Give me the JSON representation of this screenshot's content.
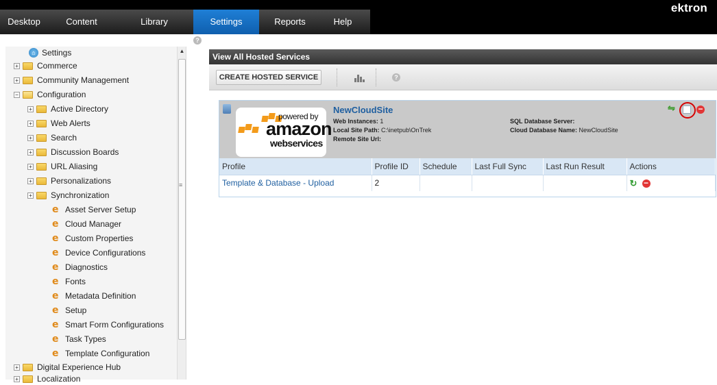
{
  "app": {
    "logo": "ektron"
  },
  "nav": {
    "tabs": [
      {
        "label": "Desktop"
      },
      {
        "label": "Content"
      },
      {
        "label": "Library"
      },
      {
        "label": "Settings",
        "active": true
      },
      {
        "label": "Reports"
      },
      {
        "label": "Help"
      }
    ]
  },
  "sidebar": {
    "root": "Settings",
    "items": [
      {
        "label": "Commerce",
        "type": "folder",
        "expander": "+"
      },
      {
        "label": "Community Management",
        "type": "folder",
        "expander": "+"
      },
      {
        "label": "Configuration",
        "type": "folder-open",
        "expander": "−"
      },
      {
        "label": "Active Directory",
        "type": "folder",
        "expander": "+"
      },
      {
        "label": "Web Alerts",
        "type": "folder",
        "expander": "+"
      },
      {
        "label": "Search",
        "type": "folder",
        "expander": "+"
      },
      {
        "label": "Discussion Boards",
        "type": "folder",
        "expander": "+"
      },
      {
        "label": "URL Aliasing",
        "type": "folder",
        "expander": "+"
      },
      {
        "label": "Personalizations",
        "type": "folder",
        "expander": "+"
      },
      {
        "label": "Synchronization",
        "type": "folder",
        "expander": "+"
      },
      {
        "label": "Asset Server Setup",
        "type": "page"
      },
      {
        "label": "Cloud Manager",
        "type": "page"
      },
      {
        "label": "Custom Properties",
        "type": "page"
      },
      {
        "label": "Device Configurations",
        "type": "page"
      },
      {
        "label": "Diagnostics",
        "type": "page"
      },
      {
        "label": "Fonts",
        "type": "page"
      },
      {
        "label": "Metadata Definition",
        "type": "page"
      },
      {
        "label": "Setup",
        "type": "page"
      },
      {
        "label": "Smart Form Configurations",
        "type": "page"
      },
      {
        "label": "Task Types",
        "type": "page"
      },
      {
        "label": "Template Configuration",
        "type": "page"
      },
      {
        "label": "Digital Experience Hub",
        "type": "folder",
        "expander": "+"
      },
      {
        "label": "Localization",
        "type": "folder",
        "expander": "+"
      }
    ]
  },
  "main": {
    "title": "View All Hosted Services",
    "create_label": "CREATE HOSTED SERVICE",
    "site": {
      "name": "NewCloudSite",
      "logo_powered": "powered by",
      "logo_amazon": "amazon",
      "logo_ws": "webservices",
      "web_instances_label": "Web Instances:",
      "web_instances_value": "1",
      "local_path_label": "Local Site Path:",
      "local_path_value": "C:\\inetpub\\OnTrek",
      "remote_url_label": "Remote Site Url:",
      "remote_url_value": "",
      "sql_label": "SQL Database Server:",
      "sql_value": "",
      "cloud_db_label": "Cloud Database Name:",
      "cloud_db_value": "NewCloudSite"
    },
    "table": {
      "headers": [
        "Profile",
        "Profile ID",
        "Schedule",
        "Last Full Sync",
        "Last Run Result",
        "Actions"
      ],
      "rows": [
        {
          "profile": "Template & Database - Upload",
          "profile_id": "2",
          "schedule": "",
          "last_full_sync": "",
          "last_run_result": ""
        }
      ]
    }
  }
}
